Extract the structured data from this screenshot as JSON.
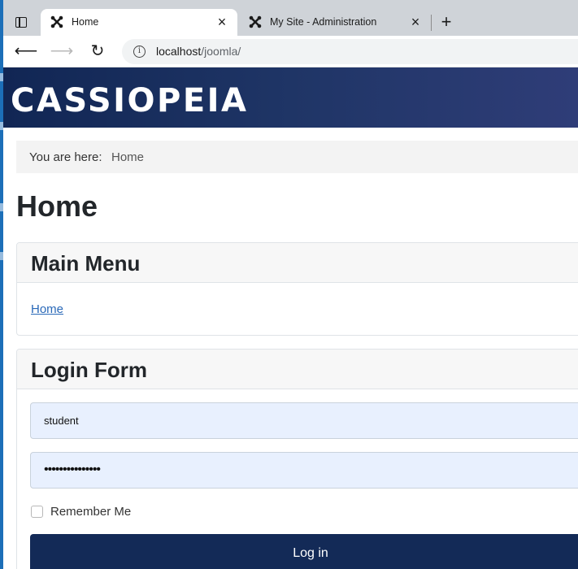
{
  "browser": {
    "tabs": [
      {
        "label": "Home",
        "icon": "joomla-icon",
        "active": true
      },
      {
        "label": "My Site - Administration",
        "icon": "joomla-icon",
        "active": false
      }
    ],
    "new_tab_label": "+",
    "url_host": "localhost",
    "url_path": "/joomla/"
  },
  "site": {
    "brand": "CASSIOPEIA",
    "breadcrumb": {
      "prefix": "You are here:",
      "current": "Home"
    },
    "page_title": "Home",
    "main_menu": {
      "title": "Main Menu",
      "items": [
        "Home"
      ]
    },
    "login": {
      "title": "Login Form",
      "username_value": "student",
      "password_value": "•••••••••••••••",
      "remember_label": "Remember Me",
      "submit_label": "Log in"
    }
  },
  "colors": {
    "header_start": "#112654",
    "header_end": "#2f3d78",
    "button_bg": "#132a57",
    "link": "#2a69b8",
    "autofill_bg": "#e8f0fe"
  }
}
